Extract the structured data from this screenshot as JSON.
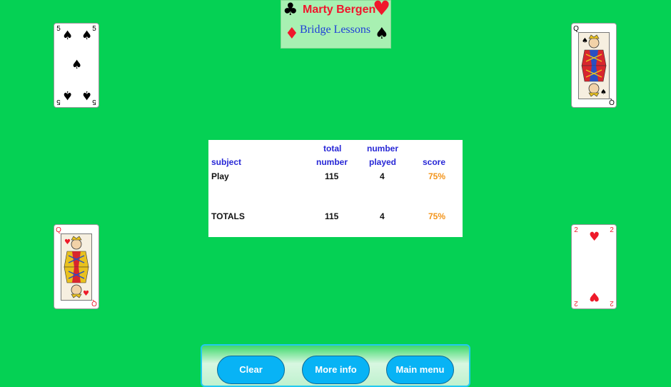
{
  "logo": {
    "title": "Marty Bergen",
    "subtitle": "Bridge Lessons"
  },
  "colors": {
    "table_felt": "#05d154",
    "header_text": "#2727d6",
    "score_text": "#f3941a",
    "button_fill": "#08b3f5",
    "logo_title": "#f0162c",
    "logo_subtitle": "#1f3fd8"
  },
  "cards": {
    "top_left": {
      "rank": "5",
      "suit": "spades"
    },
    "top_right": {
      "rank": "Q",
      "suit": "spades"
    },
    "bottom_left": {
      "rank": "Q",
      "suit": "hearts"
    },
    "bottom_right": {
      "rank": "2",
      "suit": "hearts"
    }
  },
  "stats": {
    "headers": {
      "subject": "subject",
      "total_line1": "total",
      "total_line2": "number",
      "played_line1": "number",
      "played_line2": "played",
      "score": "score"
    },
    "rows": [
      {
        "subject": "Play",
        "total": "115",
        "played": "4",
        "score": "75%"
      }
    ],
    "totals": {
      "label": "TOTALS",
      "total": "115",
      "played": "4",
      "score": "75%"
    }
  },
  "buttons": {
    "clear": "Clear",
    "more_info": "More info",
    "main_menu": "Main menu"
  }
}
